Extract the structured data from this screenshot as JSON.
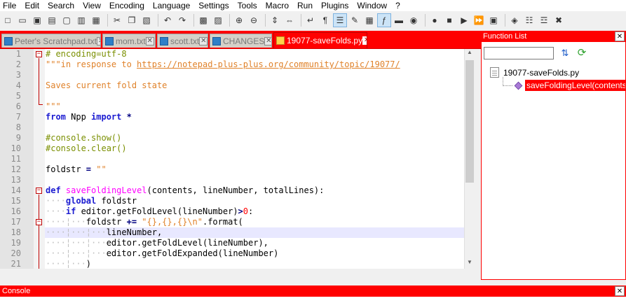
{
  "menu": [
    "File",
    "Edit",
    "Search",
    "View",
    "Encoding",
    "Language",
    "Settings",
    "Tools",
    "Macro",
    "Run",
    "Plugins",
    "Window",
    "?"
  ],
  "toolbar": [
    {
      "name": "new-file-icon",
      "glyph": "□"
    },
    {
      "name": "open-file-icon",
      "glyph": "▭"
    },
    {
      "name": "save-icon",
      "glyph": "▣"
    },
    {
      "name": "save-all-icon",
      "glyph": "▤"
    },
    {
      "name": "close-icon",
      "glyph": "▢"
    },
    {
      "name": "close-all-icon",
      "glyph": "▥"
    },
    {
      "name": "print-icon",
      "glyph": "▦"
    },
    {
      "name": "sep"
    },
    {
      "name": "cut-icon",
      "glyph": "✂"
    },
    {
      "name": "copy-icon",
      "glyph": "❐"
    },
    {
      "name": "paste-icon",
      "glyph": "▧"
    },
    {
      "name": "sep"
    },
    {
      "name": "undo-icon",
      "glyph": "↶"
    },
    {
      "name": "redo-icon",
      "glyph": "↷"
    },
    {
      "name": "sep"
    },
    {
      "name": "find-icon",
      "glyph": "▩"
    },
    {
      "name": "replace-icon",
      "glyph": "▨"
    },
    {
      "name": "sep"
    },
    {
      "name": "zoom-in-icon",
      "glyph": "⊕"
    },
    {
      "name": "zoom-out-icon",
      "glyph": "⊖"
    },
    {
      "name": "sep"
    },
    {
      "name": "sync-vertical-icon",
      "glyph": "⇕"
    },
    {
      "name": "sync-horizontal-icon",
      "glyph": "⇔"
    },
    {
      "name": "sep"
    },
    {
      "name": "word-wrap-icon",
      "glyph": "↵"
    },
    {
      "name": "show-all-chars-icon",
      "glyph": "¶"
    },
    {
      "name": "indent-guide-icon",
      "glyph": "☰",
      "on": true
    },
    {
      "name": "udl-icon",
      "glyph": "✎"
    },
    {
      "name": "doc-map-icon",
      "glyph": "▦"
    },
    {
      "name": "function-list-icon",
      "glyph": "ƒ",
      "on": true
    },
    {
      "name": "folder-workspace-icon",
      "glyph": "▬"
    },
    {
      "name": "monitoring-icon",
      "glyph": "◉"
    },
    {
      "name": "sep"
    },
    {
      "name": "record-macro-icon",
      "glyph": "●"
    },
    {
      "name": "stop-record-icon",
      "glyph": "■"
    },
    {
      "name": "play-macro-icon",
      "glyph": "▶"
    },
    {
      "name": "run-macro-multiple-icon",
      "glyph": "⏩"
    },
    {
      "name": "save-macro-icon",
      "glyph": "▣"
    },
    {
      "name": "sep"
    },
    {
      "name": "plugin-a-icon",
      "glyph": "◈"
    },
    {
      "name": "plugin-b-icon",
      "glyph": "☷"
    },
    {
      "name": "plugin-c-icon",
      "glyph": "☲"
    },
    {
      "name": "plugin-d-icon",
      "glyph": "✖"
    }
  ],
  "tabs": [
    {
      "label": "Peter's Scratchpad.txt",
      "active": false
    },
    {
      "label": "mom.txt",
      "active": false
    },
    {
      "label": "scott.txt",
      "active": false
    },
    {
      "label": "CHANGES",
      "active": false
    },
    {
      "label": "19077-saveFolds.py",
      "active": true
    }
  ],
  "editor": {
    "line_numbers": [
      "1",
      "2",
      "3",
      "4",
      "5",
      "6",
      "7",
      "8",
      "9",
      "10",
      "11",
      "12",
      "13",
      "14",
      "15",
      "16",
      "17",
      "18",
      "19",
      "20",
      "21"
    ],
    "current_line": 18
  },
  "function_list": {
    "title": "Function List",
    "search_value": "",
    "root": "19077-saveFolds.py",
    "child": "saveFoldingLevel(contents"
  },
  "console": {
    "title": "Console"
  },
  "colors": {
    "accent": "#ff0000",
    "keyword": "#1b1bd1",
    "function": "#ff00ff",
    "comment": "#7a8f00",
    "string": "#e0822a"
  }
}
